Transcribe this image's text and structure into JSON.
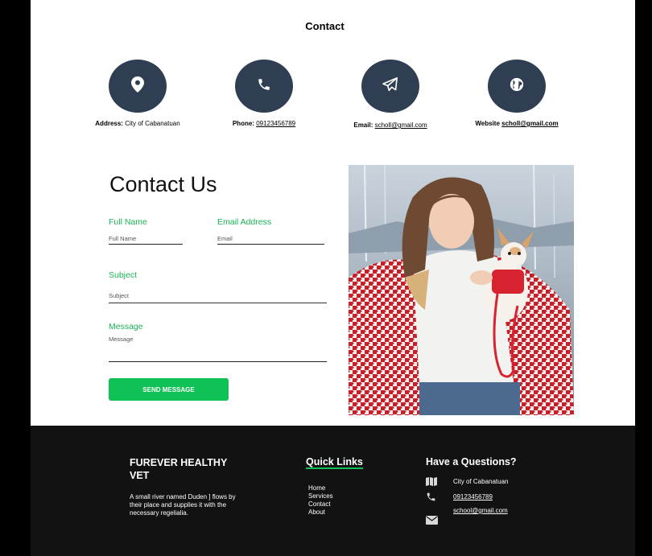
{
  "contact_section": {
    "title": "Contact",
    "items": [
      {
        "icon": "map-pin-icon",
        "label": "Address:",
        "value": "City of Cabanatuan"
      },
      {
        "icon": "phone-icon",
        "label": "Phone:",
        "value": "09123456789"
      },
      {
        "icon": "send-icon",
        "label": "Email:",
        "value": "scholl@gmail.com"
      },
      {
        "icon": "globe-icon",
        "label": "Website",
        "value": "scholl@gmail.com"
      }
    ]
  },
  "form": {
    "heading": "Contact Us",
    "full_name_label": "Full Name",
    "full_name_placeholder": "Full Name",
    "email_label": "Email Address",
    "email_placeholder": "Email",
    "subject_label": "Subject",
    "subject_placeholder": "Subject",
    "message_label": "Message",
    "message_placeholder": "Message",
    "send_label": "SEND MESSAGE"
  },
  "footer": {
    "brand": "FUREVER HEALTHY VET",
    "brand_desc": "A small river named Duden ] flows by their place and supplies it with the necessary regelialia.",
    "quick_links_title": "Quick Links",
    "quick_links": [
      "Home",
      "Services",
      "Contact",
      "About"
    ],
    "questions_title": "Have a Questions?",
    "address": "City of Cabanatuan",
    "phone": "09123456789",
    "email": "school@gmail.com"
  },
  "colors": {
    "accent": "#10c155",
    "circle": "#2f3e52",
    "footer_bg": "#121212"
  }
}
